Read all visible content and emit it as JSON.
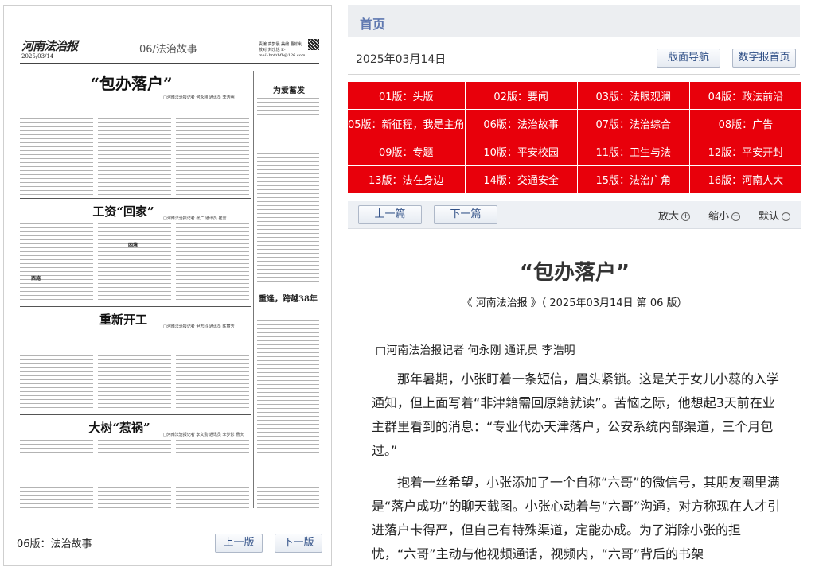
{
  "left": {
    "masthead": {
      "logo": "河南法治报",
      "date": "2025/03/14",
      "section": "06/法治故事",
      "editors": "责编 高梦晨 美编 曹松利 校对 刘乐恬 E-mail:hnfzbfb@126.com"
    },
    "articles": [
      {
        "title": "“包办落户”",
        "byline": "□河南法治报记者 何永刚 通讯员 李浩明"
      },
      {
        "title": "工资“回家”",
        "byline": "□河南法治报记者 张广 通讯员 崔雷"
      },
      {
        "title": "重新开工",
        "byline": "□河南法治报记者 尹志科 通讯员 陈丽芳"
      },
      {
        "title": "大树“惹祸”",
        "byline": "□河南法治报记者 李文勤 通讯员 李梦影 杨庆"
      }
    ],
    "sidebar": {
      "title1": "为爱蓄发",
      "title2": "重逢，跨越38年",
      "sub1": "困境",
      "sub2": "西施"
    },
    "footer": {
      "label": "06版：法治故事",
      "prev": "上一版",
      "next": "下一版"
    }
  },
  "nav": {
    "home": "首页"
  },
  "datebar": {
    "date": "2025年03月14日",
    "nav_btn": "版面导航",
    "home_btn": "数字报首页"
  },
  "pages": [
    "01版：头版",
    "02版：要闻",
    "03版：法眼观澜",
    "04版：政法前沿",
    "05版：新征程，我是主角",
    "06版：法治故事",
    "07版：法治综合",
    "08版：广告",
    "09版：专题",
    "10版：平安校园",
    "11版：卫生与法",
    "12版：平安开封",
    "13版：法在身边",
    "14版：交通安全",
    "15版：法治广角",
    "16版：河南人大"
  ],
  "toolbar": {
    "prev": "上一篇",
    "next": "下一篇",
    "zoom_in": "放大",
    "zoom_out": "缩小",
    "default": "默认",
    "zoom_in_icon": "+",
    "zoom_out_icon": "−"
  },
  "article": {
    "title": "“包办落户”",
    "source": "《 河南法治报 》（ 2025年03月14日 第 06 版）",
    "byline": "□河南法治报记者 何永刚 通讯员 李浩明",
    "paragraphs": [
      "那年暑期，小张盯着一条短信，眉头紧锁。这是关于女儿小蕊的入学通知，但上面写着“非津籍需回原籍就读”。苦恼之际，他想起3天前在业主群里看到的消息：“专业代办天津落户，公安系统内部渠道，三个月包过。”",
      "抱着一丝希望，小张添加了一个自称“六哥”的微信号，其朋友圈里满是“落户成功”的聊天截图。小张心动着与“六哥”沟通，对方称现在人才引进落户卡得严，但自己有特殊渠道，定能办成。为了消除小张的担忧，“六哥”主动与他视频通话，视频内，“六哥”背后的书架"
    ]
  }
}
